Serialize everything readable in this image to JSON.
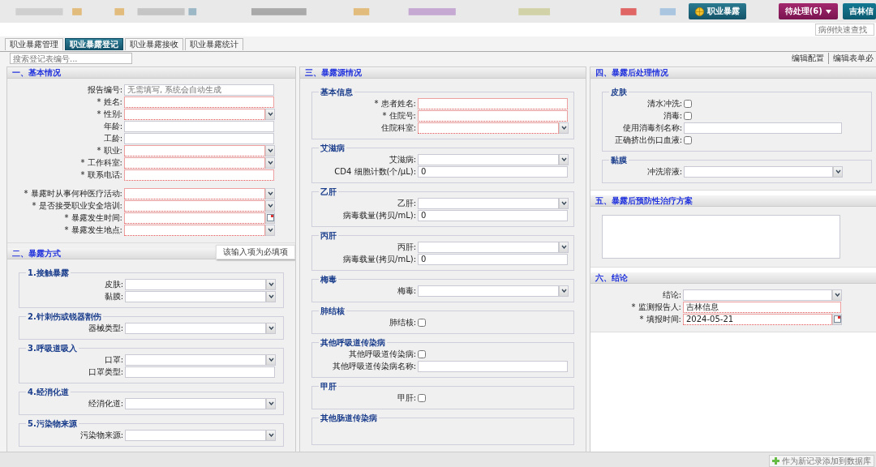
{
  "header": {
    "buttons": [
      {
        "label": "职业暴露",
        "kind": "app"
      },
      {
        "label": "待处理(6)",
        "kind": "dropdown"
      },
      {
        "label": "吉林信",
        "kind": "user"
      }
    ],
    "quick_search": {
      "placeholder": "病例快速查找"
    }
  },
  "tabs": [
    {
      "label": "职业暴露管理",
      "selected": false
    },
    {
      "label": "职业暴露登记",
      "selected": true
    },
    {
      "label": "职业暴露接收",
      "selected": false
    },
    {
      "label": "职业暴露统计",
      "selected": false
    }
  ],
  "toolbar": {
    "search": {
      "placeholder": "搜索登记表编号..."
    },
    "links": [
      "编辑配置",
      "编辑表单必"
    ]
  },
  "columns": [
    {
      "sections": [
        {
          "title": "一、基本情况",
          "fields": [
            {
              "label": "报告编号:",
              "kind": "text",
              "required": false,
              "placeholder": "无需填写, 系统会自动生成"
            },
            {
              "label": "* 姓名:",
              "kind": "text",
              "required": true
            },
            {
              "label": "* 性别:",
              "kind": "select",
              "required": true
            },
            {
              "label": "年龄:",
              "kind": "text",
              "required": false
            },
            {
              "label": "工龄:",
              "kind": "text",
              "required": false
            },
            {
              "label": "* 职业:",
              "kind": "select",
              "required": true
            },
            {
              "label": "* 工作科室:",
              "kind": "select",
              "required": true
            },
            {
              "label": "* 联系电话:",
              "kind": "text",
              "required": true
            },
            {
              "label": "* 暴露时从事何种医疗活动:",
              "kind": "select",
              "required": true
            },
            {
              "label": "* 是否接受职业安全培训:",
              "kind": "select",
              "required": true
            },
            {
              "label": "* 暴露发生时间:",
              "kind": "date",
              "required": true
            },
            {
              "label": "* 暴露发生地点:",
              "kind": "select",
              "required": true
            }
          ]
        },
        {
          "title": "二、暴露方式",
          "tooltip": "该输入项为必填项",
          "groups": [
            {
              "title": "1.接触暴露",
              "fields": [
                {
                  "label": "皮肤:",
                  "kind": "select",
                  "required": false
                },
                {
                  "label": "黏膜:",
                  "kind": "select",
                  "required": false
                }
              ]
            },
            {
              "title": "2.针刺伤或锐器割伤",
              "fields": [
                {
                  "label": "器械类型:",
                  "kind": "select",
                  "required": false
                }
              ]
            },
            {
              "title": "3.呼吸道吸入",
              "fields": [
                {
                  "label": "口罩:",
                  "kind": "select",
                  "required": false
                },
                {
                  "label": "口罩类型:",
                  "kind": "text",
                  "required": false
                }
              ]
            },
            {
              "title": "4.经消化道",
              "fields": [
                {
                  "label": "经消化道:",
                  "kind": "select",
                  "required": false
                }
              ]
            },
            {
              "title": "5.污染物来源",
              "fields": [
                {
                  "label": "污染物来源:",
                  "kind": "select",
                  "required": false
                }
              ]
            }
          ]
        }
      ]
    },
    {
      "sections": [
        {
          "title": "三、暴露源情况",
          "groups": [
            {
              "title": "基本信息",
              "fields": [
                {
                  "label": "* 患者姓名:",
                  "kind": "text",
                  "required": true
                },
                {
                  "label": "* 住院号:",
                  "kind": "text",
                  "required": true
                },
                {
                  "label": "住院科室:",
                  "kind": "select",
                  "required": true
                }
              ]
            },
            {
              "title": "艾滋病",
              "fields": [
                {
                  "label": "艾滋病:",
                  "kind": "select",
                  "required": false
                },
                {
                  "label": "CD4 细胞计数(个/μL):",
                  "kind": "text",
                  "required": false,
                  "value": "0"
                }
              ]
            },
            {
              "title": "乙肝",
              "fields": [
                {
                  "label": "乙肝:",
                  "kind": "select",
                  "required": false
                },
                {
                  "label": "病毒载量(拷贝/mL):",
                  "kind": "text",
                  "required": false,
                  "value": "0"
                }
              ]
            },
            {
              "title": "丙肝",
              "fields": [
                {
                  "label": "丙肝:",
                  "kind": "select",
                  "required": false
                },
                {
                  "label": "病毒载量(拷贝/mL):",
                  "kind": "text",
                  "required": false,
                  "value": "0"
                }
              ]
            },
            {
              "title": "梅毒",
              "fields": [
                {
                  "label": "梅毒:",
                  "kind": "select",
                  "required": false
                }
              ]
            },
            {
              "title": "肺结核",
              "fields": [
                {
                  "label": "肺结核:",
                  "kind": "checkbox",
                  "checked": false
                }
              ]
            },
            {
              "title": "其他呼吸道传染病",
              "fields": [
                {
                  "label": "其他呼吸道传染病:",
                  "kind": "checkbox",
                  "checked": false
                },
                {
                  "label": "其他呼吸道传染病名称:",
                  "kind": "text",
                  "required": false
                }
              ]
            },
            {
              "title": "甲肝",
              "fields": [
                {
                  "label": "甲肝:",
                  "kind": "checkbox",
                  "checked": false
                }
              ]
            },
            {
              "title": "其他肠道传染病"
            }
          ]
        }
      ]
    },
    {
      "sections": [
        {
          "title": "四、暴露后处理情况",
          "groups": [
            {
              "title": "皮肤",
              "fields": [
                {
                  "label": "清水冲洗:",
                  "kind": "checkbox",
                  "checked": false
                },
                {
                  "label": "消毒:",
                  "kind": "checkbox",
                  "checked": false
                },
                {
                  "label": "使用消毒剂名称:",
                  "kind": "text",
                  "required": false
                },
                {
                  "label": "正确挤出伤口血液:",
                  "kind": "checkbox",
                  "checked": false
                }
              ]
            },
            {
              "title": "黏膜",
              "fields": [
                {
                  "label": "冲洗溶液:",
                  "kind": "select",
                  "required": false
                }
              ]
            }
          ]
        },
        {
          "title": "五、暴露后预防性治疗方案",
          "fields": [
            {
              "kind": "textarea"
            }
          ]
        },
        {
          "title": "六、结论",
          "fields": [
            {
              "label": "结论:",
              "kind": "select",
              "required": false
            },
            {
              "label": "* 监测报告人:",
              "kind": "text",
              "required": true,
              "value": "吉林信息"
            },
            {
              "label": "* 填报时间:",
              "kind": "date",
              "required": true,
              "value": "2024-05-21"
            }
          ]
        }
      ]
    }
  ],
  "footer": {
    "button": "作为新记录添加到数据库"
  }
}
